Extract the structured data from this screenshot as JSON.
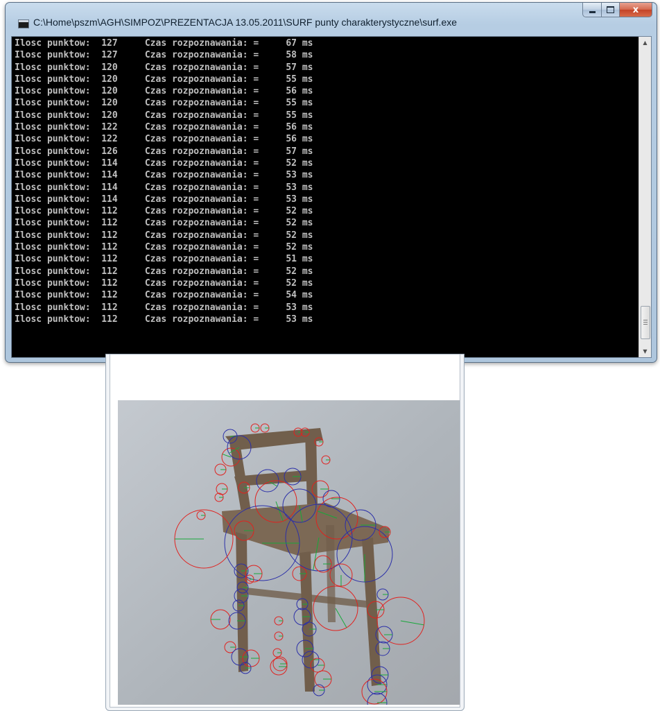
{
  "window": {
    "title": "C:\\Home\\pszm\\AGH\\SIMPOZ\\PREZENTACJA 13.05.2011\\SURF punty charakterystyczne\\surf.exe",
    "close_glyph": "x"
  },
  "console": {
    "lines": [
      "Ilosc punktow:  127     Czas rozpoznawania: =     67 ms",
      "Ilosc punktow:  127     Czas rozpoznawania: =     58 ms",
      "Ilosc punktow:  120     Czas rozpoznawania: =     57 ms",
      "Ilosc punktow:  120     Czas rozpoznawania: =     55 ms",
      "Ilosc punktow:  120     Czas rozpoznawania: =     56 ms",
      "Ilosc punktow:  120     Czas rozpoznawania: =     55 ms",
      "Ilosc punktow:  120     Czas rozpoznawania: =     55 ms",
      "Ilosc punktow:  122     Czas rozpoznawania: =     56 ms",
      "Ilosc punktow:  122     Czas rozpoznawania: =     56 ms",
      "Ilosc punktow:  126     Czas rozpoznawania: =     57 ms",
      "Ilosc punktow:  114     Czas rozpoznawania: =     52 ms",
      "Ilosc punktow:  114     Czas rozpoznawania: =     53 ms",
      "Ilosc punktow:  114     Czas rozpoznawania: =     53 ms",
      "Ilosc punktow:  114     Czas rozpoznawania: =     53 ms",
      "Ilosc punktow:  112     Czas rozpoznawania: =     52 ms",
      "Ilosc punktow:  112     Czas rozpoznawania: =     52 ms",
      "Ilosc punktow:  112     Czas rozpoznawania: =     52 ms",
      "Ilosc punktow:  112     Czas rozpoznawania: =     52 ms",
      "Ilosc punktow:  112     Czas rozpoznawania: =     51 ms",
      "Ilosc punktow:  112     Czas rozpoznawania: =     52 ms",
      "Ilosc punktow:  112     Czas rozpoznawania: =     52 ms",
      "Ilosc punktow:  112     Czas rozpoznawania: =     54 ms",
      "Ilosc punktow:  112     Czas rozpoznawania: =     53 ms",
      "Ilosc punktow:  112     Czas rozpoznawania: =     53 ms"
    ],
    "text_color": "#c0c0c0",
    "background": "#000000"
  },
  "image_view": {
    "subject": "chair",
    "marker_colors": {
      "red": "#e0221f",
      "blue": "#2b2fa8",
      "green": "#18a83a"
    }
  }
}
